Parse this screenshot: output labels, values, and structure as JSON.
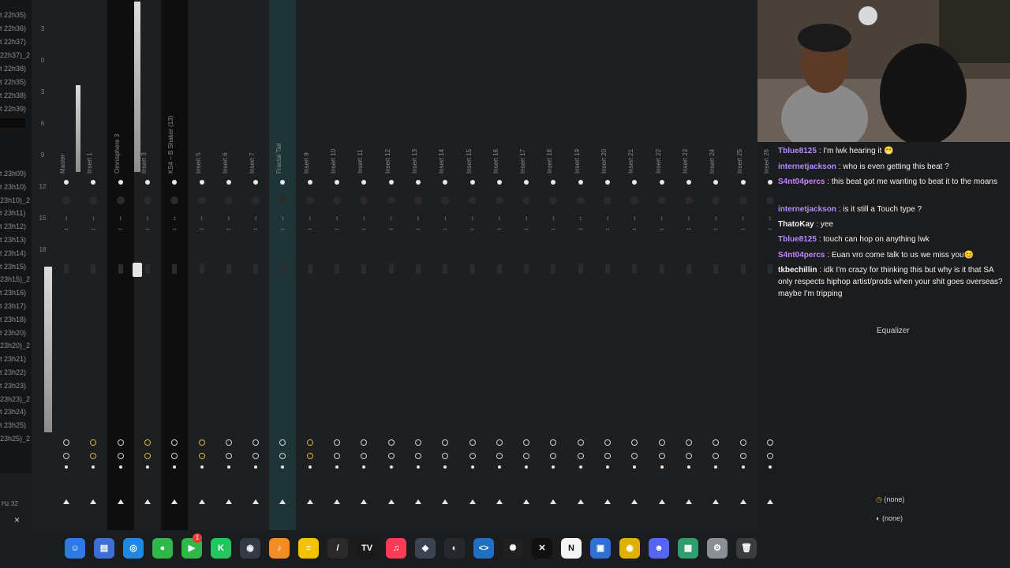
{
  "pattern_list": {
    "items": [
      "t 22h35)",
      "t 22h36)",
      "t 22h37)",
      "22h37)_2",
      "t 22h38)",
      "t 22h35)",
      "t 22h38)",
      "t 22h39)",
      "t 23h09)",
      "t 23h10)",
      "23h10)_2",
      "t 23h11)",
      "t 23h12)",
      "t 23h13)",
      "t 23h14)",
      "t 23h15)",
      "23h15)_2",
      "t 23h16)",
      "t 23h17)",
      "t 23h18)",
      "t 23h20)",
      "23h20)_2",
      "t 23h21)",
      "t 23h22)",
      "t 23h23)",
      "23h23)_2",
      "t 23h24)",
      "t 23h25)",
      "23h25)_2"
    ]
  },
  "db_scale": [
    "3",
    "0",
    "3",
    "6",
    "9",
    "12",
    "15",
    "18"
  ],
  "mixer": {
    "tracks": [
      "Master",
      "Insert 1",
      "Omnisphere 3",
      "Insert 3",
      "KS4 – B Shaker (13)",
      "Insert 5",
      "Insert 6",
      "Insert 7",
      "Fractal Tail",
      "Insert 9",
      "Insert 10",
      "Insert 11",
      "Insert 12",
      "Insert 13",
      "Insert 14",
      "Insert 15",
      "Insert 16",
      "Insert 17",
      "Insert 18",
      "Insert 19",
      "Insert 20",
      "Insert 21",
      "Insert 22",
      "Insert 23",
      "Insert 24",
      "Insert 25",
      "Insert 26"
    ]
  },
  "chat": {
    "messages": [
      {
        "user": "Tblue8125",
        "text": ": I'm lwk hearing it 😁",
        "color": "#b18cff"
      },
      {
        "user": "internetjackson",
        "text": ": who is even getting this beat ?",
        "color": "#b18cff"
      },
      {
        "user": "S4nt04percs",
        "text": ": this beat got me wanting to beat it to the moans",
        "color": "#c783ff"
      },
      {
        "user": "internetjackson",
        "text": ": is it still a Touch type ?",
        "color": "#b18cff"
      },
      {
        "user": "ThatoKay",
        "text": ": yee",
        "color": "#f2f2f2"
      },
      {
        "user": "Tblue8125",
        "text": ": touch can hop on anything lwk",
        "color": "#b18cff"
      },
      {
        "user": "S4nt04percs",
        "text": ": Euan vro come talk to us we miss you😊",
        "color": "#c783ff"
      },
      {
        "user": "tkbechillin",
        "text": ": idk I'm crazy for thinking this but why is it that SA only respects hiphop artist/prods when your shit goes overseas? maybe I'm tripping",
        "color": "#f2f2f2"
      }
    ]
  },
  "equalizer_label": "Equalizer",
  "routing": {
    "input": "(none)",
    "output": "(none)"
  },
  "bottom_left": {
    "label": "Hz 32",
    "close": "×"
  },
  "dock": {
    "apps": [
      {
        "name": "finder",
        "glyph": "☺",
        "color": "#2d7be5"
      },
      {
        "name": "files",
        "glyph": "▤",
        "color": "#3b6fd6"
      },
      {
        "name": "safari",
        "glyph": "◎",
        "color": "#1e88e5"
      },
      {
        "name": "messages",
        "glyph": "●",
        "color": "#2fb84a"
      },
      {
        "name": "facetime",
        "glyph": "▶",
        "color": "#2fb84a"
      },
      {
        "name": "kick",
        "glyph": "K",
        "color": "#22c55e"
      },
      {
        "name": "obs",
        "glyph": "◉",
        "color": "#333a44"
      },
      {
        "name": "fl-studio",
        "glyph": "♪",
        "color": "#f28c28"
      },
      {
        "name": "notes",
        "glyph": "≡",
        "color": "#f2c200"
      },
      {
        "name": "pen",
        "glyph": "/",
        "color": "#2a2a2a"
      },
      {
        "name": "tradingview",
        "glyph": "TV",
        "color": "#1a1a1a"
      },
      {
        "name": "music",
        "glyph": "♫",
        "color": "#fa3c55"
      },
      {
        "name": "davinci",
        "glyph": "◆",
        "color": "#3a4452"
      },
      {
        "name": "github",
        "glyph": "◐",
        "color": "#24292e"
      },
      {
        "name": "vscode",
        "glyph": "<>",
        "color": "#1f6fc5"
      },
      {
        "name": "chatgpt",
        "glyph": "✺",
        "color": "#202020"
      },
      {
        "name": "capcut",
        "glyph": "✕",
        "color": "#111111"
      },
      {
        "name": "notion",
        "glyph": "N",
        "color": "#f5f5f5"
      },
      {
        "name": "launcher",
        "glyph": "▣",
        "color": "#2f6fd6"
      },
      {
        "name": "chrome",
        "glyph": "◉",
        "color": "#e0b000"
      },
      {
        "name": "discord",
        "glyph": "☻",
        "color": "#5865f2"
      },
      {
        "name": "adblock",
        "glyph": "▦",
        "color": "#2f9e6f"
      },
      {
        "name": "settings",
        "glyph": "⚙",
        "color": "#8a8f95"
      },
      {
        "name": "trash",
        "glyph": "🗑",
        "color": "#3a3c40"
      }
    ],
    "badge": "1"
  },
  "colors": {
    "accent": "#d8b23a",
    "bg": "#1b1c1e",
    "teal": "#1f3436"
  }
}
